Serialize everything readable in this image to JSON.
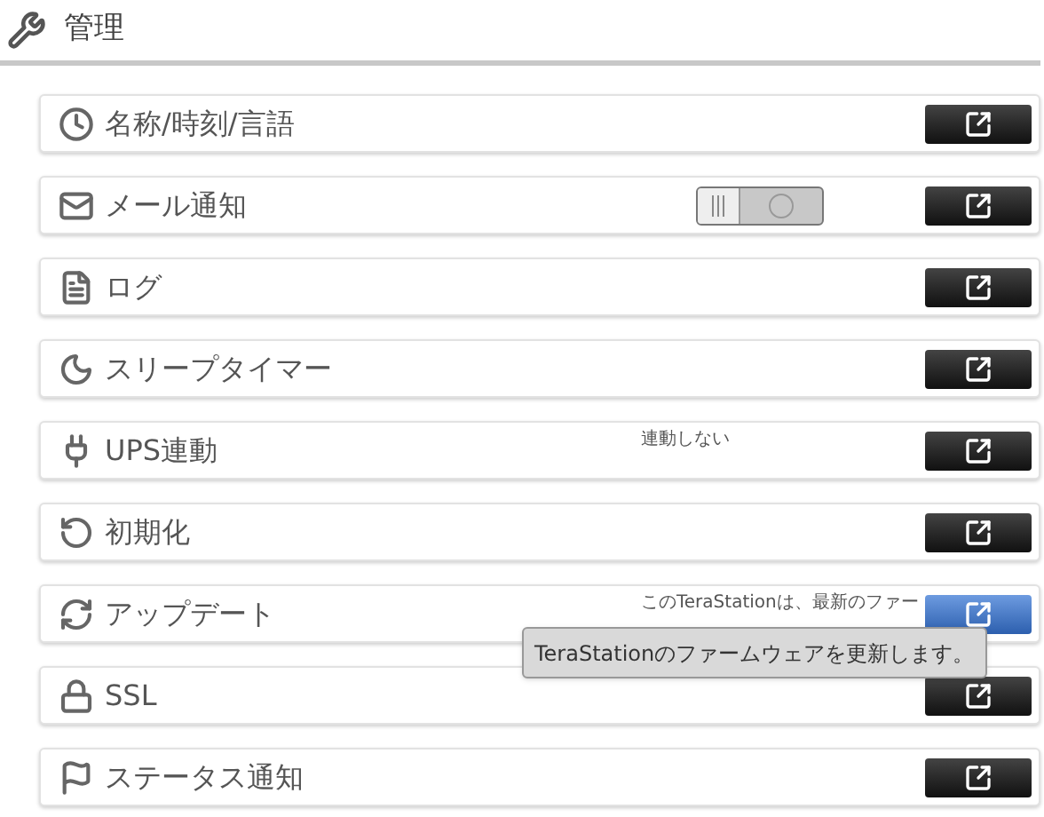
{
  "header": {
    "title": "管理"
  },
  "rows": [
    {
      "kind": "link",
      "label": "名称/時刻/言語",
      "highlighted": false
    },
    {
      "kind": "toggle",
      "label": "メール通知",
      "on": false,
      "highlighted": false
    },
    {
      "kind": "link",
      "label": "ログ",
      "highlighted": false
    },
    {
      "kind": "link",
      "label": "スリープタイマー",
      "highlighted": false
    },
    {
      "kind": "link",
      "label": "UPS連動",
      "status": "連動しない",
      "highlighted": false
    },
    {
      "kind": "link",
      "label": "初期化",
      "highlighted": false
    },
    {
      "kind": "link",
      "label": "アップデート",
      "status": "このTeraStationは、最新のファー",
      "highlighted": true
    },
    {
      "kind": "link",
      "label": "SSL",
      "highlighted": false
    },
    {
      "kind": "link",
      "label": "ステータス通知",
      "highlighted": false
    }
  ],
  "tooltip": {
    "text": "TeraStationのファームウェアを更新します。"
  }
}
